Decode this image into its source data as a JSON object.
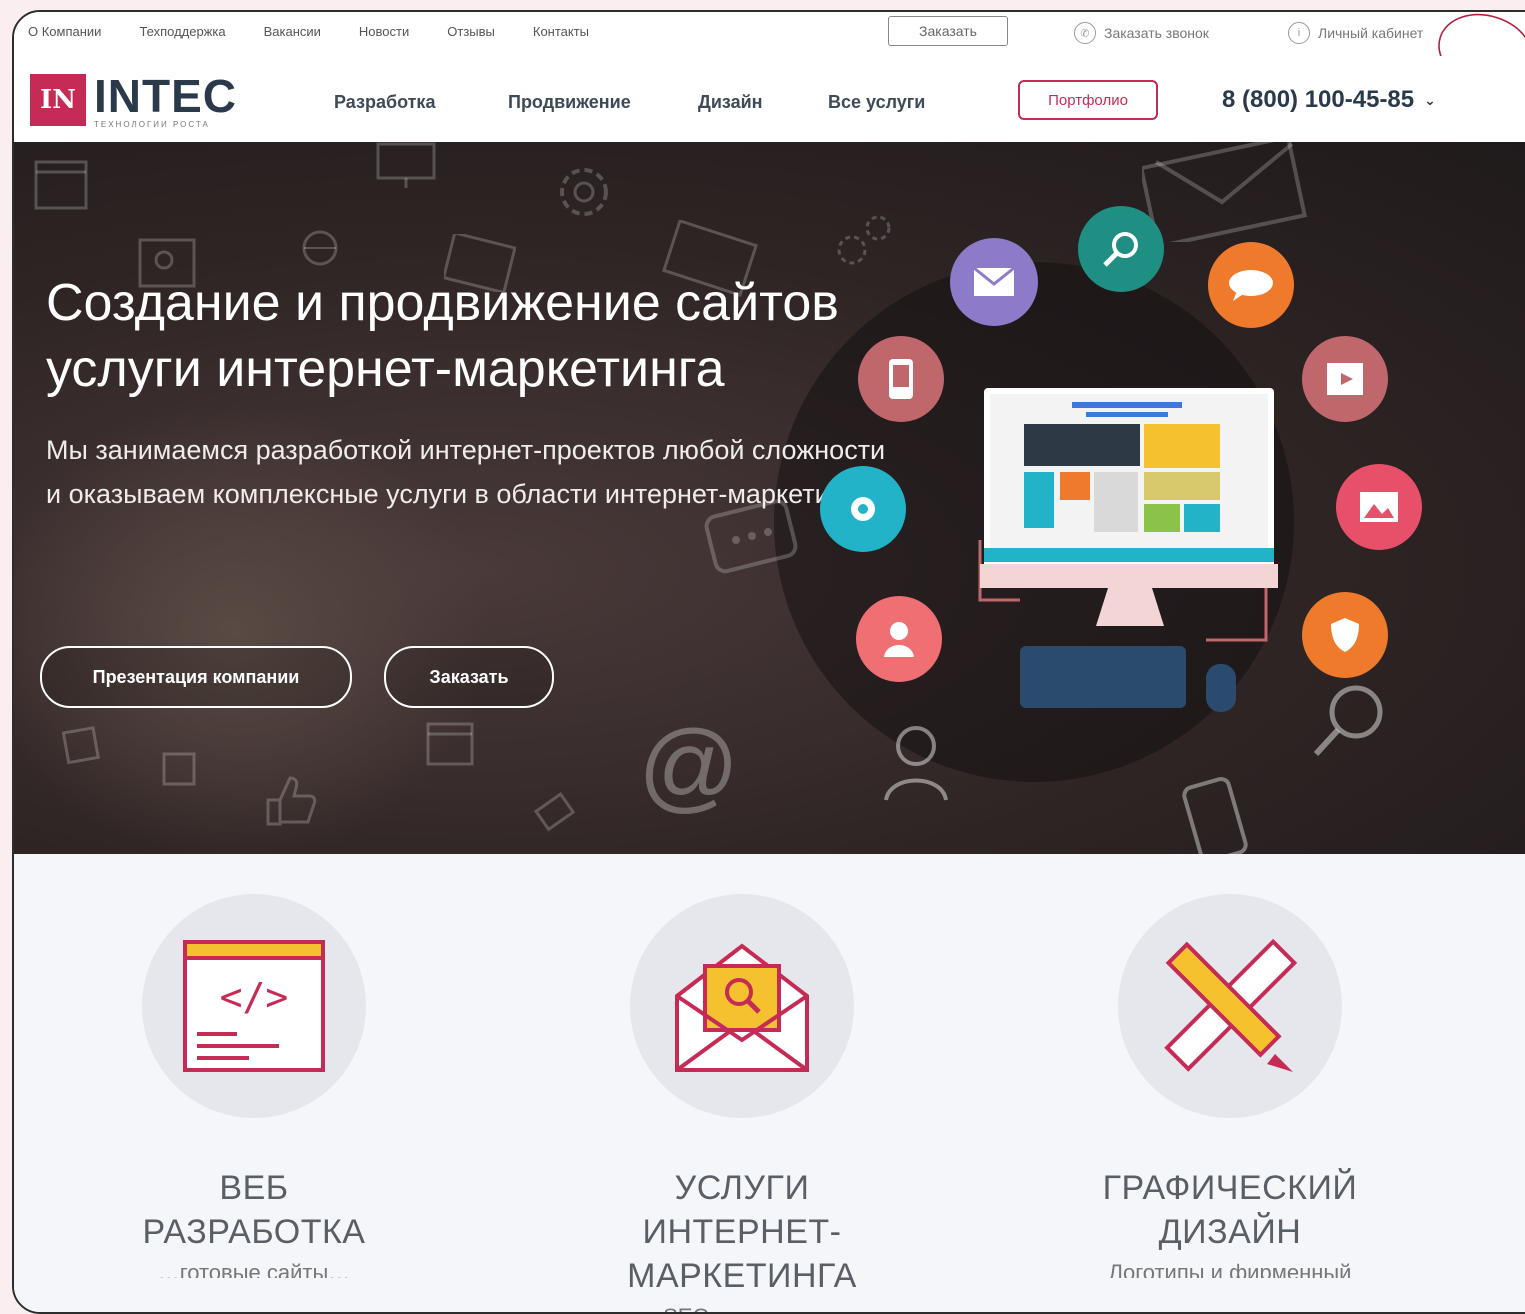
{
  "topbar": {
    "links": [
      "О Компании",
      "Техподдержка",
      "Вакансии",
      "Новости",
      "Отзывы",
      "Контакты"
    ],
    "order_button": "Заказать",
    "callback": "Заказать звонок",
    "cabinet": "Личный кабинет"
  },
  "header": {
    "logo_mark": "IN",
    "logo_word": "INTEC",
    "logo_tagline": "ТЕХНОЛОГИИ РОСТА",
    "nav": [
      "Разработка",
      "Продвижение",
      "Дизайн",
      "Все услуги"
    ],
    "portfolio_button": "Портфолио",
    "phone": "8 (800) 100-45-85"
  },
  "hero": {
    "title_line1": "Создание и продвижение сайтов",
    "title_line2": "услуги интернет-маркетинга",
    "subtitle_line1": "Мы занимаемся разработкой интернет-проектов любой сложности",
    "subtitle_line2": "и оказываем комплексные услуги в области интернет-маркетинга",
    "btn_presentation": "Презентация компании",
    "btn_order": "Заказать",
    "decor_at": "@"
  },
  "services": [
    {
      "title_line1": "ВЕБ",
      "title_line2": "РАЗРАБОТКА",
      "teaser": "…готовые сайты…"
    },
    {
      "title_line1": "УСЛУГИ",
      "title_line2": "ИНТЕРНЕТ-МАРКЕТИНГА",
      "teaser": "SEO и реклама"
    },
    {
      "title_line1": "ГРАФИЧЕСКИЙ",
      "title_line2": "ДИЗАЙН",
      "teaser": "Логотипы и фирменный"
    }
  ],
  "colors": {
    "brand": "#c52b54",
    "navy": "#2b3a4a",
    "hero_bg": "#2e2424",
    "bubble_purple": "#8d7ac9",
    "bubble_teal": "#1f8f84",
    "bubble_orange": "#f07a2b",
    "bubble_rose": "#c0676b",
    "bubble_pink": "#e8506a",
    "bubble_cyan": "#22b3c9",
    "bubble_coral": "#ef6f72"
  }
}
